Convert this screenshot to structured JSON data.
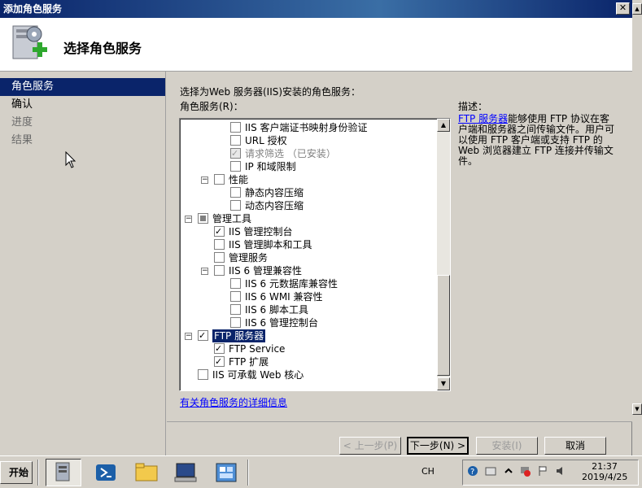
{
  "window": {
    "title": "添加角色服务",
    "close_glyph": "✕"
  },
  "header": {
    "title": "选择角色服务"
  },
  "sidebar": {
    "items": [
      {
        "label": "角色服务",
        "state": "active"
      },
      {
        "label": "确认",
        "state": "normal"
      },
      {
        "label": "进度",
        "state": "disabled"
      },
      {
        "label": "结果",
        "state": "disabled"
      }
    ]
  },
  "main": {
    "prompt": "选择为Web 服务器(IIS)安装的角色服务：",
    "list_label": "角色服务(R)：",
    "tree": [
      {
        "label": "IIS 客户端证书映射身份验证",
        "checked": false
      },
      {
        "label": "URL 授权",
        "checked": false
      },
      {
        "label": "请求筛选  （已安装）",
        "checked": true,
        "disabled": true
      },
      {
        "label": "IP 和域限制",
        "checked": false
      },
      {
        "label": "性能",
        "checked": false,
        "expander": "−"
      },
      {
        "label": "静态内容压缩",
        "checked": false
      },
      {
        "label": "动态内容压缩",
        "checked": false
      },
      {
        "label": "管理工具",
        "checked": "partial",
        "expander": "−"
      },
      {
        "label": "IIS 管理控制台",
        "checked": true
      },
      {
        "label": "IIS 管理脚本和工具",
        "checked": false
      },
      {
        "label": "管理服务",
        "checked": false
      },
      {
        "label": "IIS 6 管理兼容性",
        "checked": false,
        "expander": "−"
      },
      {
        "label": "IIS 6 元数据库兼容性",
        "checked": false
      },
      {
        "label": "IIS 6 WMI 兼容性",
        "checked": false
      },
      {
        "label": "IIS 6 脚本工具",
        "checked": false
      },
      {
        "label": "IIS 6 管理控制台",
        "checked": false
      },
      {
        "label": "FTP 服务器",
        "checked": true,
        "expander": "−",
        "selected": true
      },
      {
        "label": "FTP Service",
        "checked": true
      },
      {
        "label": "FTP 扩展",
        "checked": true
      },
      {
        "label": "IIS 可承载 Web 核心",
        "checked": false
      }
    ],
    "description_title": "描述：",
    "description_link": "FTP 服务器",
    "description_text": "能够使用 FTP 协议在客户端和服务器之间传输文件。用户可以使用 FTP 客户端或支持 FTP 的 Web 浏览器建立 FTP 连接并传输文件。",
    "more_info_link": "有关角色服务的详细信息"
  },
  "buttons": {
    "prev": "< 上一步(P)",
    "next": "下一步(N) >",
    "install": "安装(I)",
    "cancel": "取消"
  },
  "taskbar": {
    "start_label": "开始",
    "lang": "CH",
    "time": "21:37",
    "date": "2019/4/25"
  },
  "colors": {
    "titlebar": "#0a246a",
    "selection": "#0a246a",
    "link": "#0000ff",
    "face": "#d4d0c8"
  }
}
